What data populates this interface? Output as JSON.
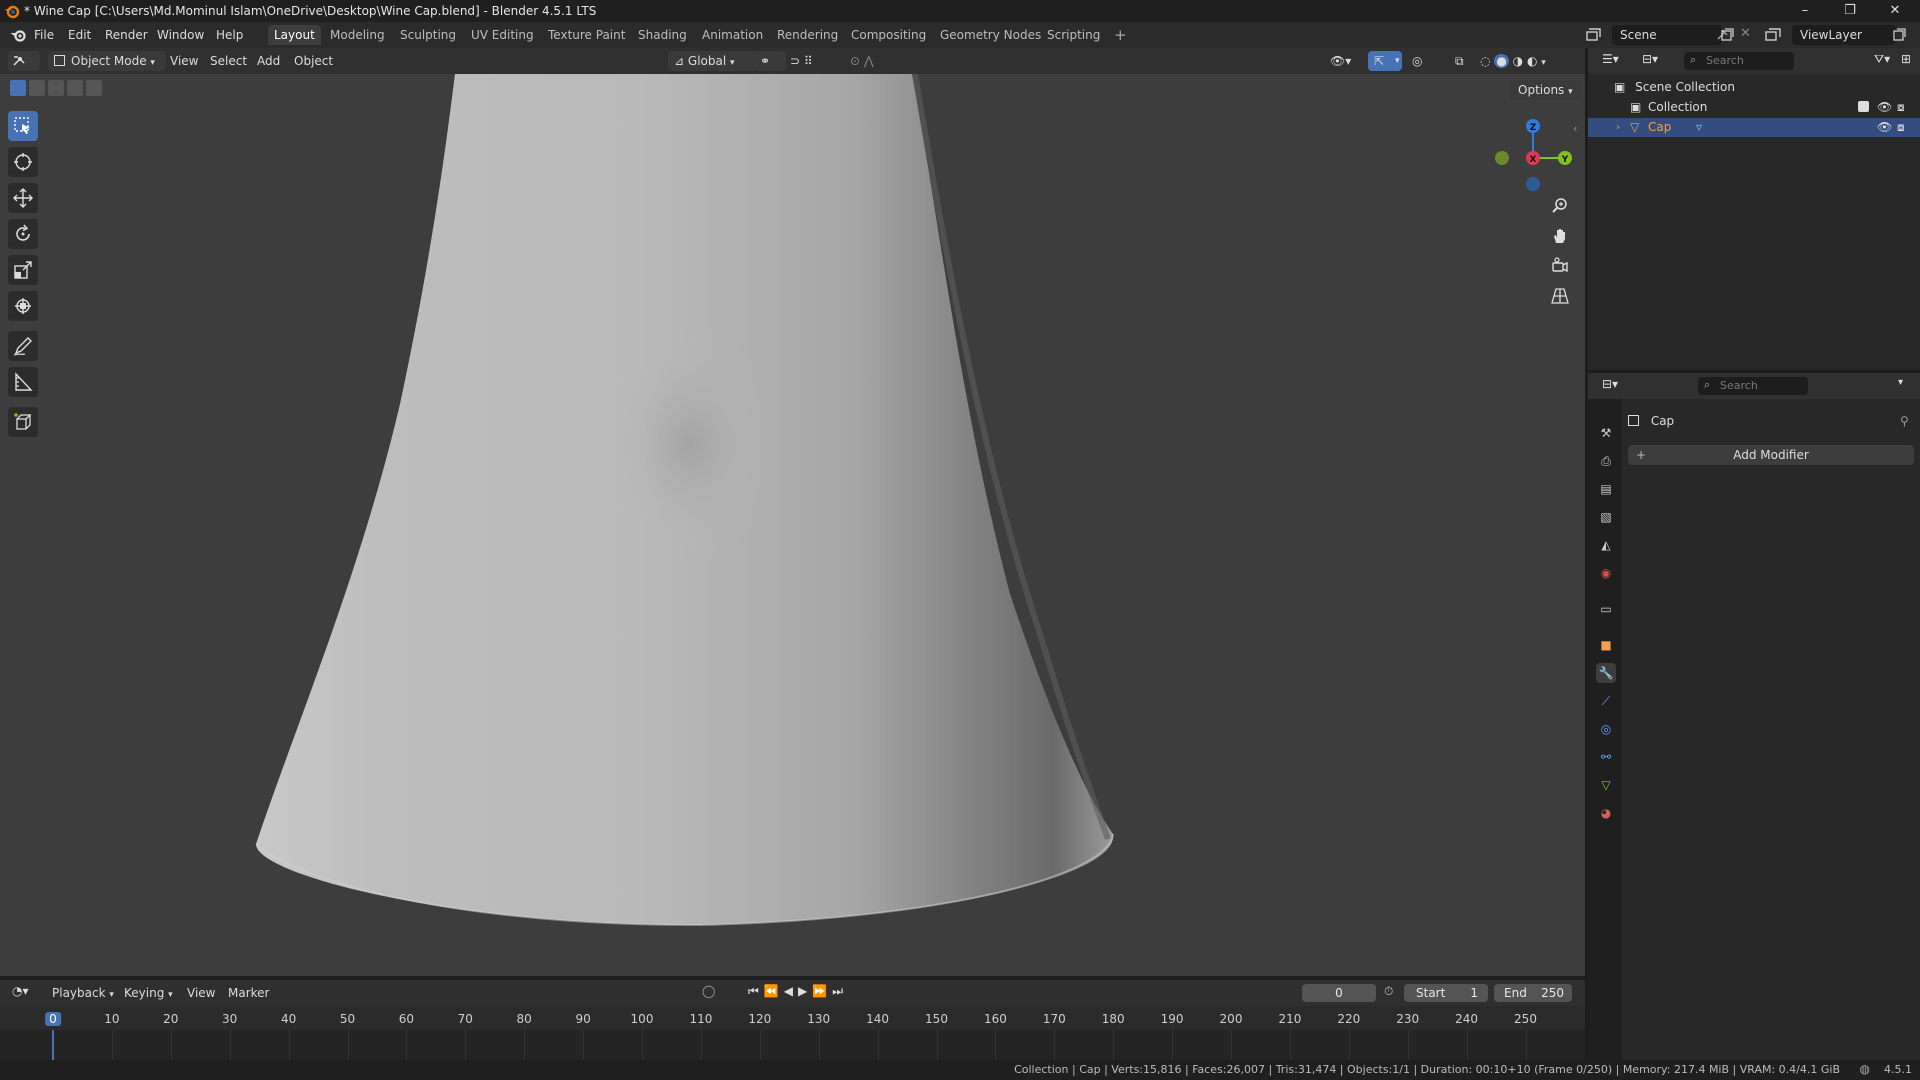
{
  "window": {
    "title": "* Wine Cap [C:\\Users\\Md.Mominul Islam\\OneDrive\\Desktop\\Wine Cap.blend] - Blender 4.5.1 LTS",
    "minimize": "–",
    "maximize": "❐",
    "close": "✕"
  },
  "menu": [
    "File",
    "Edit",
    "Render",
    "Window",
    "Help"
  ],
  "workspaces": [
    "Layout",
    "Modeling",
    "Sculpting",
    "UV Editing",
    "Texture Paint",
    "Shading",
    "Animation",
    "Rendering",
    "Compositing",
    "Geometry Nodes",
    "Scripting"
  ],
  "workspace_add": "+",
  "scene": {
    "name": "Scene",
    "view_layer": "ViewLayer"
  },
  "viewport_header": {
    "mode": "Object Mode",
    "menus": [
      "View",
      "Select",
      "Add",
      "Object"
    ],
    "orientation": "Global",
    "options": "Options"
  },
  "gizmo": {
    "z": "Z",
    "x": "X",
    "y": "Y"
  },
  "outliner": {
    "search_placeholder": "Search",
    "root": "Scene Collection",
    "collection": "Collection",
    "object": "Cap"
  },
  "properties": {
    "search_placeholder": "Search",
    "object_name": "Cap",
    "add_modifier": "Add Modifier"
  },
  "timeline": {
    "menus": [
      "Playback",
      "Keying",
      "View",
      "Marker"
    ],
    "current_frame": "0",
    "start_label": "Start",
    "start": "1",
    "end_label": "End",
    "end": "250",
    "ticks": [
      "0",
      "10",
      "20",
      "30",
      "40",
      "50",
      "60",
      "70",
      "80",
      "90",
      "100",
      "110",
      "120",
      "130",
      "140",
      "150",
      "160",
      "170",
      "180",
      "190",
      "200",
      "210",
      "220",
      "230",
      "240",
      "250"
    ]
  },
  "statusbar": {
    "text": "Collection | Cap | Verts:15,816 | Faces:26,007 | Tris:31,474 | Objects:1/1 | Duration: 00:10+10 (Frame 0/250) | Memory: 217.4 MiB | VRAM: 0.4/4.1 GiB",
    "version": "4.5.1"
  },
  "colors": {
    "accent": "#4772b3",
    "axis_x": "#e13a4f",
    "axis_y": "#83c21c",
    "axis_z": "#2d7ce0"
  }
}
